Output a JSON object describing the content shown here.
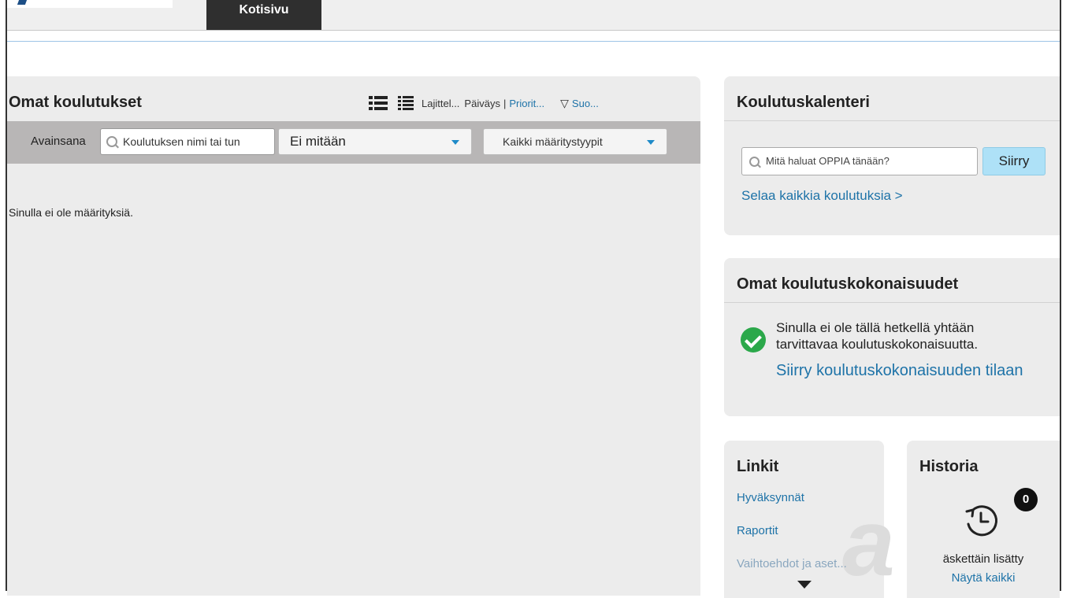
{
  "header": {
    "active_tab": "Kotisivu"
  },
  "main": {
    "title": "Omat koulutukset",
    "sort_label": "Lajittel...",
    "sort_date": "Päiväys",
    "sort_separator": "|",
    "sort_priority": "Priorit...",
    "filter_label": "Suo...",
    "keyword_label": "Avainsana",
    "keyword_placeholder": "Koulutuksen nimi tai tun",
    "select_status": "Ei mitään",
    "select_types": "Kaikki määritystyypit",
    "empty_message": "Sinulla ei ole määrityksiä."
  },
  "calendar": {
    "title": "Koulutuskalenteri",
    "search_placeholder": "Mitä haluat OPPIA tänään?",
    "go_button": "Siirry",
    "browse_link": "Selaa kaikkia koulutuksia >"
  },
  "programs": {
    "title": "Omat koulutuskokonaisuudet",
    "message": "Sinulla ei ole tällä hetkellä yhtään tarvittavaa koulutuskokonaisuutta.",
    "link": "Siirry koulutuskokonaisuuden tilaan"
  },
  "links": {
    "title": "Linkit",
    "items": [
      "Hyväksynnät",
      "Raportit",
      "Vaihtoehdot ja aset..."
    ]
  },
  "history": {
    "title": "Historia",
    "count": "0",
    "label": "äskettäin lisätty",
    "show_all": "Näytä kaikki"
  },
  "colors": {
    "link": "#1e73a8",
    "go_button": "#aee1f7",
    "check": "#2ba84a",
    "filterbar": "#b8b6b6"
  },
  "icons": [
    "list-view-icon",
    "compact-list-icon",
    "filter-icon",
    "search-icon",
    "caret-down-icon",
    "check-circle-icon",
    "history-clock-icon",
    "arrow-down-icon"
  ]
}
